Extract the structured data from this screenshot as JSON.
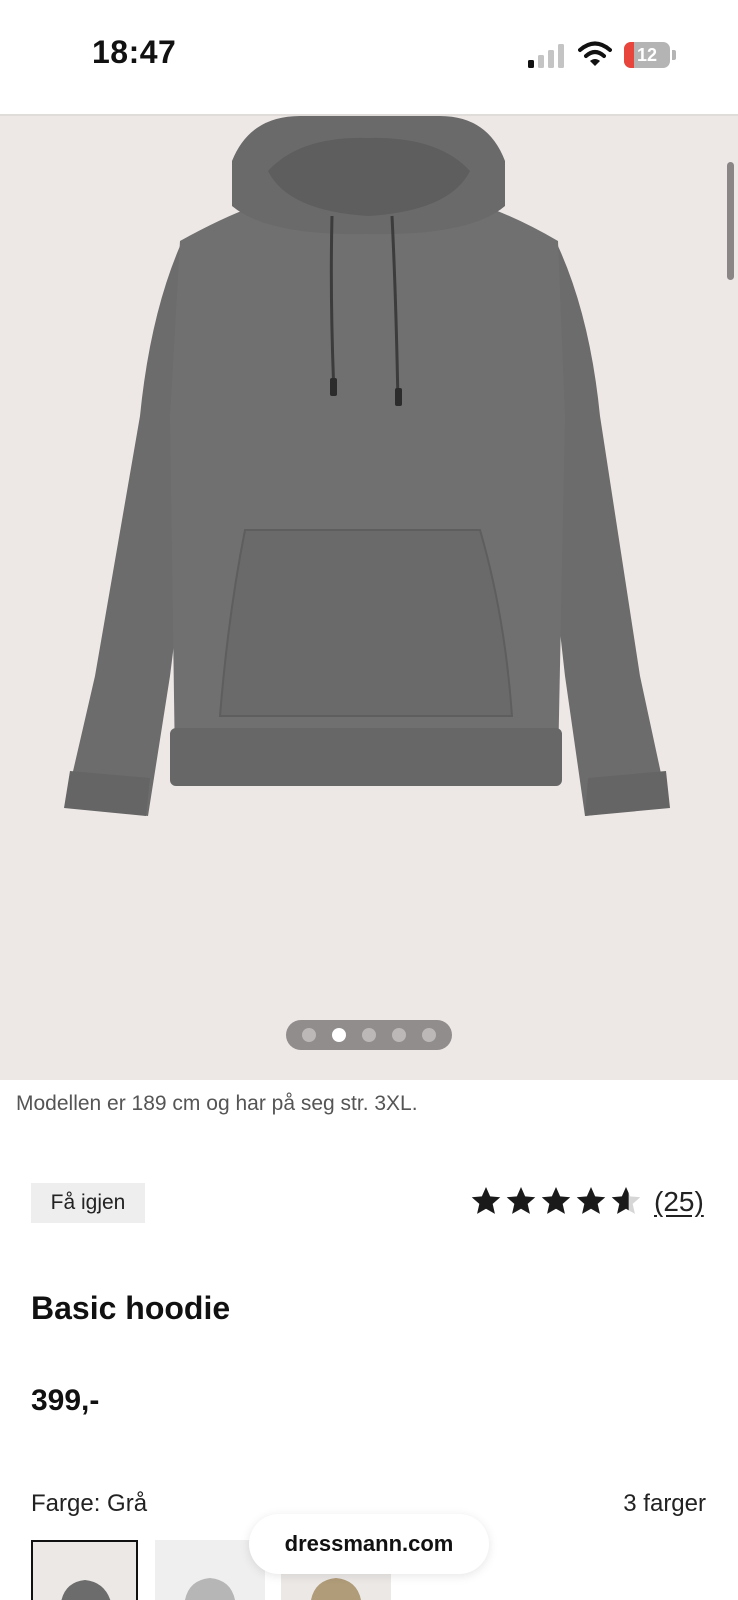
{
  "status_bar": {
    "time": "18:47",
    "battery_level": "12",
    "battery_fraction": 0.12,
    "signal_bars": 1,
    "icons": [
      "signal-icon",
      "wifi-icon",
      "battery-icon"
    ]
  },
  "gallery": {
    "image": "grey-hoodie-product-photo",
    "active_index": 1,
    "total": 5
  },
  "model_note": "Modellen er 189 cm og har på seg str. 3XL.",
  "badge": "Få igjen",
  "rating": {
    "stars": 4.5,
    "max": 5,
    "count": "(25)"
  },
  "product": {
    "title": "Basic hoodie",
    "price": "399,-"
  },
  "color": {
    "label": "Farge: Grå",
    "count": "3 farger",
    "swatches": [
      "Grå",
      "Lys grå",
      "Beige"
    ]
  },
  "browser": {
    "url": "dressmann.com"
  },
  "colors": {
    "hoodie": "#6e6e6e",
    "background": "#ede8e6",
    "star": "#1a1a1a"
  }
}
